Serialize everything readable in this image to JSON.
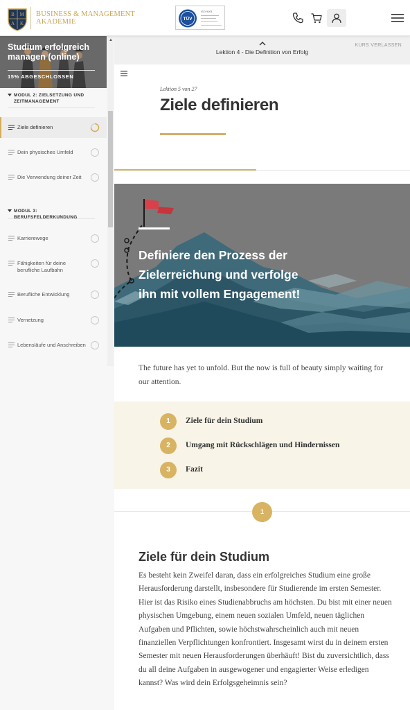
{
  "header": {
    "logo_line1": "BUSINESS & MANAGEMENT",
    "logo_line2": "AKADEMIE",
    "logo_letters": [
      "B",
      "M",
      "A",
      "K"
    ],
    "cert_lines": [
      "ISO 9001",
      "TÜV"
    ],
    "icons": [
      "phone-icon",
      "cart-icon",
      "user-icon",
      "menu-icon"
    ]
  },
  "sidebar": {
    "course_title": "Studium erfolgreich managen (online)",
    "progress_label": "15% ABGESCHLOSSEN",
    "progress_percent": 15,
    "modules": [
      {
        "title": "MODUL 2: ZIELSETZUNG UND ZEITMANAGEMENT",
        "lessons": [
          {
            "label": "Ziele definieren",
            "active": true,
            "status": "in-progress"
          },
          {
            "label": "Dein physisches Umfeld",
            "active": false,
            "status": "open"
          },
          {
            "label": "Die Verwendung deiner Zeit",
            "active": false,
            "status": "open"
          }
        ]
      },
      {
        "title": "MODUL 3: BERUFSFELDERKUNDUNG",
        "lessons": [
          {
            "label": "Karrierewege",
            "active": false,
            "status": "open"
          },
          {
            "label": "Fähigkeiten für deine berufliche Laufbahn",
            "active": false,
            "status": "open"
          },
          {
            "label": "Berufliche Entwicklung",
            "active": false,
            "status": "open"
          },
          {
            "label": "Vernetzung",
            "active": false,
            "status": "open"
          },
          {
            "label": "Lebensläufe und Anschreiben",
            "active": false,
            "status": "open"
          }
        ]
      }
    ]
  },
  "topbar": {
    "lesson_title": "Lektion 4 - Die Definition von Erfolg",
    "exit_label": "KURS VERLASSEN"
  },
  "lesson": {
    "count": "Lektion 5 von 27",
    "title": "Ziele definieren",
    "progress_fraction": 0.48,
    "banner_text": "Definiere den Prozess der Zielerreichung und verfolge ihn mit vollem Engagement!",
    "quote": "The future has yet to unfold. But the now is full of beauty simply waiting for our attention.",
    "toc": [
      {
        "num": "1",
        "label": "Ziele für dein Studium"
      },
      {
        "num": "2",
        "label": "Umgang mit Rückschlägen und Hindernissen"
      },
      {
        "num": "3",
        "label": "Fazit"
      }
    ],
    "section": {
      "num": "1",
      "title": "Ziele für dein Studium",
      "body": "Es besteht kein Zweifel daran, dass ein erfolgreiches Studium eine große Herausforderung darstellt, insbesondere für Studierende im ersten Semester. Hier ist das Risiko eines Studienabbruchs am höchsten. Du bist mit einer neuen physischen Umgebung, einem neuen sozialen Umfeld, neuen täglichen Aufgaben und Pflichten, sowie höchstwahrscheinlich auch mit neuen finanziellen Verpflichtungen konfrontiert. Insgesamt wirst du in deinem ersten Semester mit neuen Herausforderungen überhäuft! Bist du zuversichtlich, dass du all deine Aufgaben in ausgewogener und engagierter Weise erledigen kannst? Was wird dein Erfolgsgeheimnis sein?"
    }
  },
  "colors": {
    "gold": "#cfb06a",
    "toc_bg": "#f8f4e8",
    "banner_gray": "#7a7a7a",
    "mountain_dark": "#1f4a5c",
    "flag_red": "#c4353d"
  }
}
